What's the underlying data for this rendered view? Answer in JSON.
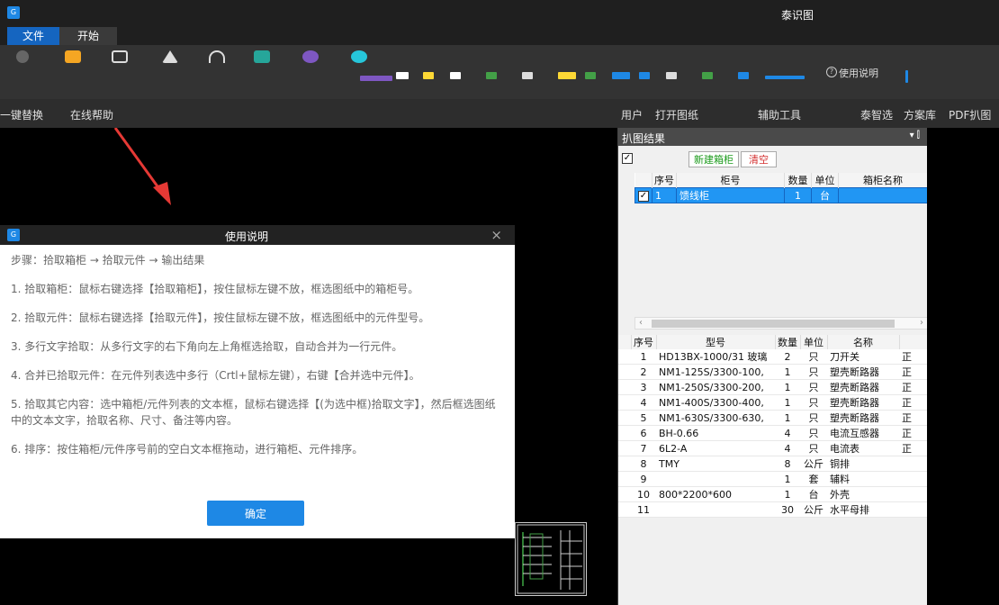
{
  "window": {
    "title": "泰识图"
  },
  "tabs": [
    {
      "label": "文件"
    },
    {
      "label": "开始"
    }
  ],
  "ribbon": {
    "help_label": "使用说明",
    "tail_text": "",
    "small_text": "一键替换"
  },
  "groups": {
    "left": [
      "一键替换",
      "在线帮助"
    ],
    "right": [
      "用户",
      "打开图纸",
      "辅助工具",
      "泰智选",
      "方案库",
      "PDF扒图"
    ]
  },
  "dialog": {
    "title": "使用说明",
    "close": "×",
    "lines": [
      "步骤：拾取箱柜 → 拾取元件 → 输出结果",
      "1. 拾取箱柜：鼠标右键选择【拾取箱柜】，按住鼠标左键不放，框选图纸中的箱柜号。",
      "2. 拾取元件：鼠标右键选择【拾取元件】，按住鼠标左键不放，框选图纸中的元件型号。",
      "3. 多行文字拾取：从多行文字的右下角向左上角框选拾取，自动合并为一行元件。",
      "4. 合并已拾取元件：在元件列表选中多行（Crtl+鼠标左键），右键【合并选中元件】。",
      "5. 拾取其它内容：选中箱柜/元件列表的文本框，鼠标右键选择【(为选中框)拾取文字】，然后框选图纸中的文本文字，拾取名称、尺寸、备注等内容。",
      "6. 排序：按住箱柜/元件序号前的空白文本框拖动，进行箱柜、元件排序。"
    ],
    "ok_label": "确定"
  },
  "panel": {
    "title": "扒图结果",
    "controls": "▾ ⫿",
    "new_cabinet": "新建箱柜",
    "clear": "清空",
    "cabinet_headers": [
      "序号",
      "柜号",
      "数量",
      "单位",
      "箱柜名称"
    ],
    "cabinets": [
      {
        "no": "1",
        "name": "馈线柜",
        "qty": "1",
        "unit": "台",
        "cab_name": ""
      }
    ],
    "component_headers": [
      "序号",
      "型号",
      "数量",
      "单位",
      "名称"
    ],
    "components": [
      {
        "no": "1",
        "model": "HD13BX-1000/31 玻璃",
        "qty": "2",
        "unit": "只",
        "name": "刀开关",
        "extra": "正"
      },
      {
        "no": "2",
        "model": "NM1-125S/3300-100,",
        "qty": "1",
        "unit": "只",
        "name": "塑壳断路器",
        "extra": "正"
      },
      {
        "no": "3",
        "model": "NM1-250S/3300-200,",
        "qty": "1",
        "unit": "只",
        "name": "塑壳断路器",
        "extra": "正"
      },
      {
        "no": "4",
        "model": "NM1-400S/3300-400,",
        "qty": "1",
        "unit": "只",
        "name": "塑壳断路器",
        "extra": "正"
      },
      {
        "no": "5",
        "model": "NM1-630S/3300-630,",
        "qty": "1",
        "unit": "只",
        "name": "塑壳断路器",
        "extra": "正"
      },
      {
        "no": "6",
        "model": "BH-0.66",
        "qty": "4",
        "unit": "只",
        "name": "电流互感器",
        "extra": "正"
      },
      {
        "no": "7",
        "model": "6L2-A",
        "qty": "4",
        "unit": "只",
        "name": "电流表",
        "extra": "正"
      },
      {
        "no": "8",
        "model": "TMY",
        "qty": "8",
        "unit": "公斤",
        "name": "铜排",
        "extra": ""
      },
      {
        "no": "9",
        "model": "",
        "qty": "1",
        "unit": "套",
        "name": "辅料",
        "extra": ""
      },
      {
        "no": "10",
        "model": "800*2200*600",
        "qty": "1",
        "unit": "台",
        "name": "外壳",
        "extra": ""
      },
      {
        "no": "11",
        "model": "",
        "qty": "30",
        "unit": "公斤",
        "name": "水平母排",
        "extra": ""
      }
    ]
  },
  "colors": {
    "accent": "#1e88e5",
    "arrow": "#e53935",
    "new_btn": "#1a9a1a",
    "clear_btn": "#d32f2f"
  }
}
